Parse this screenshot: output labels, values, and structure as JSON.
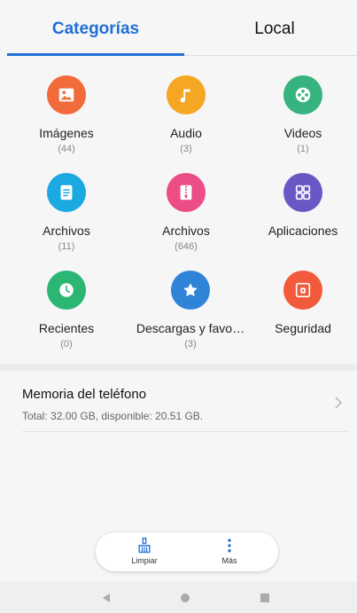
{
  "tabs": {
    "categories": "Categorías",
    "local": "Local"
  },
  "categories": [
    {
      "label": "Imágenes",
      "count": "(44)",
      "icon": "image-icon",
      "color": "#f26b3a"
    },
    {
      "label": "Audio",
      "count": "(3)",
      "icon": "music-note-icon",
      "color": "#f5a623"
    },
    {
      "label": "Videos",
      "count": "(1)",
      "icon": "film-reel-icon",
      "color": "#36b37e"
    },
    {
      "label": "Archivos",
      "count": "(11)",
      "icon": "document-icon",
      "color": "#1aa9e0"
    },
    {
      "label": "Archivos",
      "count": "(646)",
      "icon": "zip-archive-icon",
      "color": "#ec4d86"
    },
    {
      "label": "Aplicaciones",
      "count": "",
      "icon": "apps-grid-icon",
      "color": "#6b56c5"
    },
    {
      "label": "Recientes",
      "count": "(0)",
      "icon": "clock-icon",
      "color": "#2bb673"
    },
    {
      "label": "Descargas y favo…",
      "count": "(3)",
      "icon": "star-icon",
      "color": "#2f84d8"
    },
    {
      "label": "Seguridad",
      "count": "",
      "icon": "safe-icon",
      "color": "#f15a3a"
    }
  ],
  "storage": {
    "title": "Memoria del teléfono",
    "detail": "Total: 32.00 GB, disponible: 20.51 GB."
  },
  "actions": {
    "clean_label": "Limpiar",
    "more_label": "Más"
  },
  "colors": {
    "accent": "#1f6fd6"
  }
}
